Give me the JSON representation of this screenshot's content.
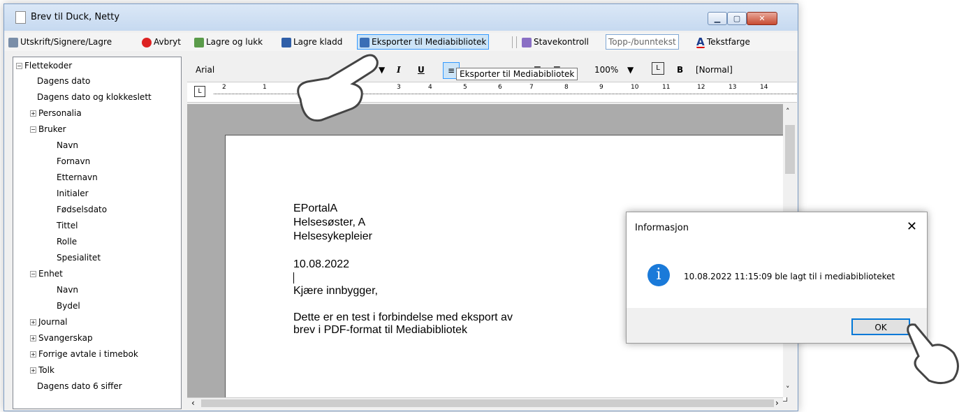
{
  "window": {
    "title": "Brev til Duck, Netty"
  },
  "toolbar": {
    "print": "Utskrift/Signere/Lagre",
    "cancel": "Avbryt",
    "save_close": "Lagre og lukk",
    "save_draft": "Lagre kladd",
    "export": "Eksporter til Mediabibliotek",
    "spellcheck": "Stavekontroll",
    "header_footer": "Topp-/bunntekst",
    "text_color": "Tekstfarge"
  },
  "tree": {
    "root": "Flettekoder",
    "items": [
      "Dagens dato",
      "Dagens dato og klokkeslett",
      "Personalia",
      "Bruker",
      "Navn",
      "Fornavn",
      "Etternavn",
      "Initialer",
      "Fødselsdato",
      "Tittel",
      "Rolle",
      "Spesialitet",
      "Enhet",
      "Navn",
      "Bydel",
      "Journal",
      "Svangerskap",
      "Forrige avtale i timebok",
      "Tolk",
      "Dagens dato 6 siffer"
    ]
  },
  "format": {
    "font": "Arial",
    "zoom": "100%",
    "style": "[Normal]",
    "italic": "I",
    "underline": "U",
    "bold": "B"
  },
  "ruler": {
    "labels": [
      "2",
      "1",
      "3",
      "4",
      "5",
      "6",
      "7",
      "8",
      "9",
      "10",
      "11",
      "12",
      "13",
      "14"
    ]
  },
  "tooltip": "Eksporter til Mediabibliotek",
  "document": {
    "lines": [
      "EPortalA",
      "Helsesøster, A",
      "Helsesykepleier",
      "10.08.2022",
      "Kjære innbygger,",
      "Dette er en test i forbindelse med eksport av",
      "brev i PDF-format til Mediabibliotek"
    ]
  },
  "dialog": {
    "title": "Informasjon",
    "message": "10.08.2022 11:15:09 ble lagt til i mediabiblioteket",
    "ok": "OK"
  },
  "colors": {
    "accent": "#0078d7",
    "highlight": "#cce4f7",
    "info": "#1a7ad9"
  }
}
